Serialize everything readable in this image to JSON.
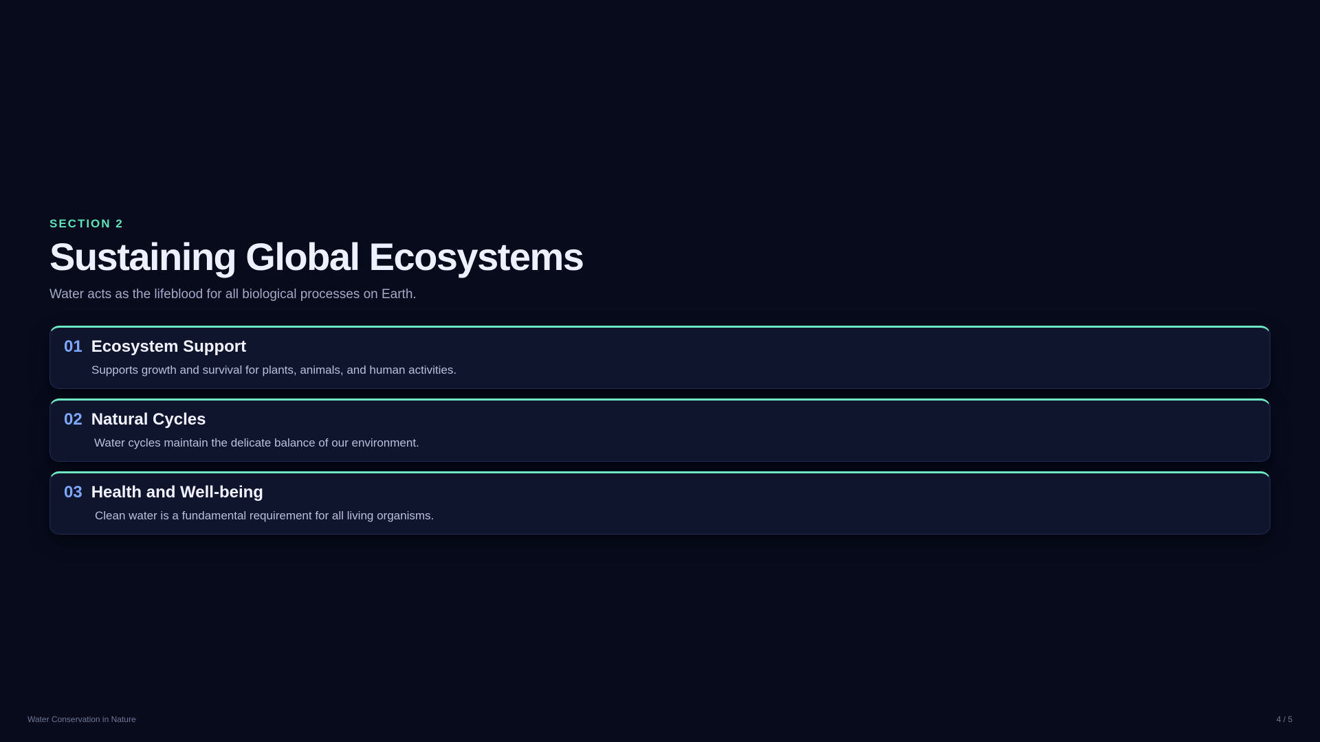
{
  "section": {
    "eyebrow": "SECTION 2",
    "title": "Sustaining Global Ecosystems",
    "subtitle": "Water acts as the lifeblood for all biological processes on Earth."
  },
  "cards": [
    {
      "number": "01",
      "title": "Ecosystem Support",
      "description": "Supports growth and survival for plants, animals, and human activities."
    },
    {
      "number": "02",
      "title": "Natural Cycles",
      "description": "Water cycles maintain the delicate balance of our environment."
    },
    {
      "number": "03",
      "title": "Health and Well-being",
      "description": "Clean water is a fundamental requirement for all living organisms."
    }
  ],
  "footer": {
    "deck_title": "Water Conservation in Nature",
    "page_indicator": "4 / 5"
  },
  "colors": {
    "background": "#070b1c",
    "accent_teal": "#6ee7c5",
    "number_blue": "#7ea8ff",
    "card_background": "#10152e"
  }
}
